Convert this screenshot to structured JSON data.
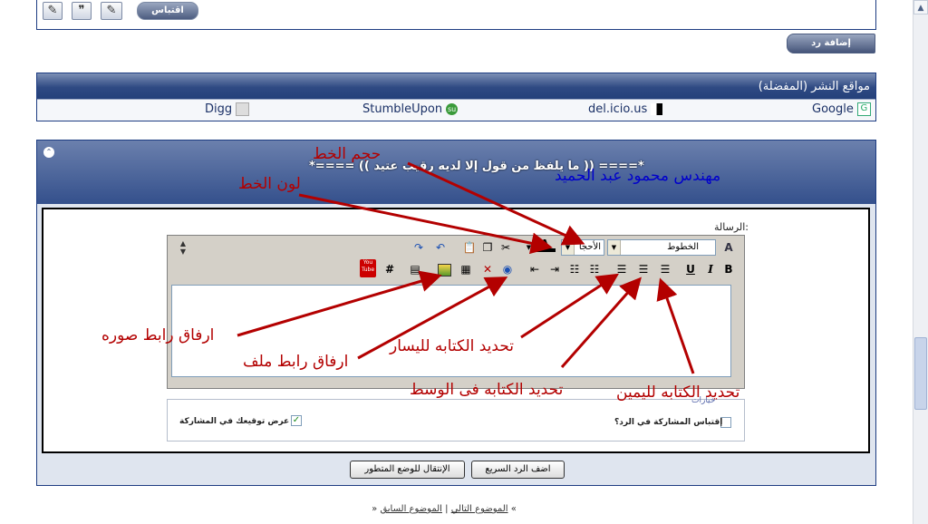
{
  "top_toolbar": {
    "quote_label": "اقتباس",
    "icon1": "✎",
    "icon2": "❞",
    "icon3": "✎"
  },
  "add_reply_label": "إضافة رد",
  "social": {
    "title": "مواقع النشر (المفضلة)",
    "items": [
      {
        "label": "Google",
        "icon": "google-icon"
      },
      {
        "label": "del.icio.us",
        "icon": "delicious-icon"
      },
      {
        "label": "StumbleUpon",
        "icon": "stumbleupon-icon"
      },
      {
        "label": "Digg",
        "icon": "digg-icon"
      }
    ]
  },
  "quick_reply": {
    "collapse_symbol": "⌃",
    "signature_user": "مهندس محمود عبد الحميد",
    "signature_text": "*==== (( ما يلفظ من قول إلا لديه رقيب عتيد )) ====*",
    "message_label": "الرسالة:",
    "font_name_label": "الخطوط",
    "font_size_label": "الأحجا",
    "options": {
      "quote_label": "إقتباس المشاركة في الرد؟",
      "signature_label": "عرض توقيعك في المشاركة",
      "signature_checkmark": "✓",
      "behind_label": "خيارات"
    },
    "buttons": {
      "post_quick": "اضف الرد السريع",
      "go_advanced": "الإنتقال للوضع المتطور"
    }
  },
  "editor_icons": {
    "bold": "B",
    "italic": "I",
    "underline": "U",
    "hash": "#",
    "youtube": "You\nTube",
    "undo": "↶",
    "redo": "↷"
  },
  "footer": {
    "prev": "الموضوع السابق",
    "separator": "|",
    "next": "الموضوع التالي",
    "left_quote": "«",
    "right_quote": "»"
  },
  "annotations": {
    "font_color": "لون الخط",
    "font_size": "حجم الخط",
    "attach_image": "ارفاق رابط صوره",
    "attach_file": "ارفاق رابط ملف",
    "align_left": "تحديد الكتابه لليسار",
    "align_center": "تحديد الكتابه فى الوسط",
    "align_right": "تحديد الكتابه لليمين"
  },
  "colors": {
    "header_blue": "#2f4a83",
    "annotation_red": "#b30000",
    "signature_blue": "#0000cc"
  }
}
